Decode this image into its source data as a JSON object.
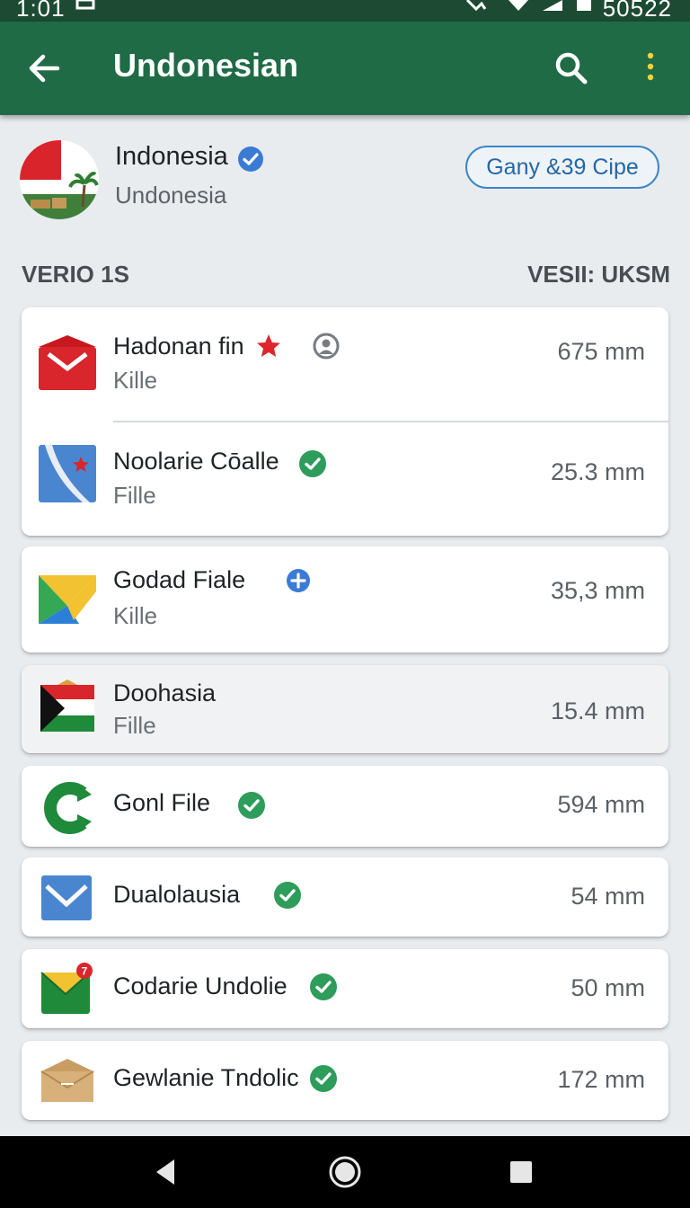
{
  "status_bar": {
    "time": "1:01",
    "battery": "50522"
  },
  "app_bar": {
    "title": "Undonesian"
  },
  "profile": {
    "name": "Indonesia",
    "subtitle": "Undonesia",
    "action_button": "Gany &39 Cipe"
  },
  "section": {
    "left": "VERIO 1S",
    "right": "VESII: UKSM"
  },
  "files": [
    {
      "name": "Hadonan fin",
      "type": "Kille",
      "size": "675 mm",
      "icon": "red-envelope-icon",
      "badges": [
        "red-star-icon",
        "person-badge-icon"
      ]
    },
    {
      "name": "Noolarie Cōalle",
      "type": "Fille",
      "size": "25.3 mm",
      "icon": "blue-map-icon",
      "badges": [
        "green-check-icon"
      ]
    },
    {
      "name": "Godad Fiale",
      "type": "Kille",
      "size": "35,3 mm",
      "icon": "color-envelope-icon",
      "badges": [
        "blue-plus-icon"
      ]
    },
    {
      "name": "Doohasia",
      "type": "Fille",
      "size": "15.4 mm",
      "icon": "tricolor-flag-icon",
      "badges": []
    },
    {
      "name": "Gonl File",
      "type": "",
      "size": "594 mm",
      "icon": "green-sync-icon",
      "badges": [
        "green-check-icon"
      ]
    },
    {
      "name": "Dualolausia",
      "type": "",
      "size": "54 mm",
      "icon": "blue-envelope-icon",
      "badges": [
        "green-check-icon"
      ]
    },
    {
      "name": "Codarie Undolie",
      "type": "",
      "size": "50 mm",
      "icon": "green-envelope-icon",
      "notification_count": "7",
      "badges": [
        "green-check-icon"
      ]
    },
    {
      "name": "Gewlanie Tndolic",
      "type": "",
      "size": "172 mm",
      "icon": "tan-envelope-icon",
      "badges": [
        "green-check-icon"
      ]
    }
  ],
  "colors": {
    "app_bar": "#1f6b45",
    "status_bar": "#1c4a32",
    "check_green": "#2e9c5a",
    "verified_blue": "#3a7bd5",
    "pill_border": "#3d86c6"
  }
}
